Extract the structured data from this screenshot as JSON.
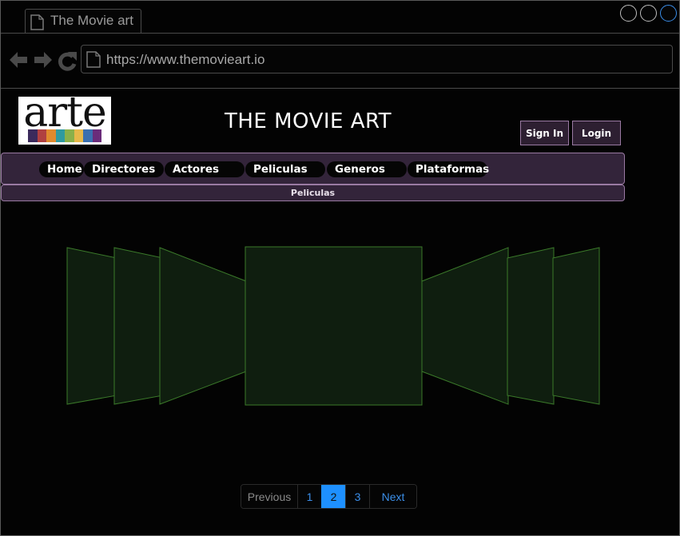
{
  "browser": {
    "tab_title": "The Movie art",
    "url": "https://www.themovieart.io",
    "icons": [
      "back-icon",
      "forward-icon",
      "reload-icon",
      "page-icon"
    ]
  },
  "header": {
    "logo_text": "arte",
    "logo_colors": [
      "#3b2a5c",
      "#b04040",
      "#e08a2e",
      "#2f9aa0",
      "#8ab04a",
      "#e6b84a",
      "#3a6fb0",
      "#6a2c7a"
    ],
    "site_title": "THE MOVIE ART",
    "sign_in_label": "Sign In",
    "login_label": "Login"
  },
  "nav": {
    "items": [
      {
        "label": "Home"
      },
      {
        "label": "Directores"
      },
      {
        "label": "Actores"
      },
      {
        "label": "Peliculas"
      },
      {
        "label": "Generos"
      },
      {
        "label": "Plataformas"
      }
    ]
  },
  "subnav": {
    "label": "Peliculas"
  },
  "carousel": {
    "slide_color": "#0f1e0f",
    "border_color": "#3b7a2a"
  },
  "pagination": {
    "previous_label": "Previous",
    "pages": [
      "1",
      "2",
      "3"
    ],
    "current": "2",
    "next_label": "Next"
  },
  "colors": {
    "background": "#030303",
    "nav_bg": "#33243a",
    "nav_border": "#9a7aa3",
    "accent": "#1e90ff"
  }
}
